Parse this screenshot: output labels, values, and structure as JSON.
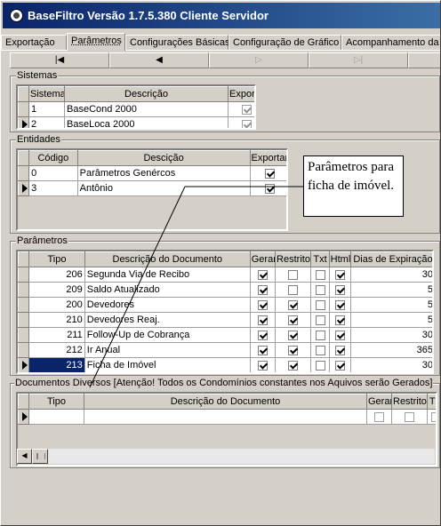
{
  "window": {
    "title": "BaseFiltro Versão 1.7.5.380 Cliente Servidor"
  },
  "tabs": [
    {
      "label": "Exportação"
    },
    {
      "label": "Parâmetros"
    },
    {
      "label": "Configurações Básicas"
    },
    {
      "label": "Configuração de Gráfico"
    },
    {
      "label": "Acompanhamento da"
    }
  ],
  "navigator": {
    "first": "|◀",
    "prior": "◀",
    "next": "▷",
    "last": "▷|"
  },
  "sistemas": {
    "legend": "Sistemas",
    "columns": [
      "Sistema",
      "Descrição",
      "Exportar"
    ],
    "rows": [
      {
        "id": "1",
        "desc": "BaseCond 2000",
        "exportar": true
      },
      {
        "id": "2",
        "desc": "BaseLoca 2000",
        "exportar": true
      }
    ]
  },
  "entidades": {
    "legend": "Entidades",
    "columns": [
      "Código",
      "Descição",
      "Exportar"
    ],
    "rows": [
      {
        "id": "0",
        "desc": "Parâmetros Genércos",
        "exportar": true
      },
      {
        "id": "3",
        "desc": "Antônio",
        "exportar": true
      }
    ]
  },
  "note": {
    "text": "Parâmetros para ficha de imóvel."
  },
  "parametros": {
    "legend": "Parâmetros",
    "columns": [
      "Tipo",
      "Descrição do Documento",
      "Gerar",
      "Restrito",
      "Txt",
      "Html",
      "Dias de Expiração"
    ],
    "rows": [
      {
        "tipo": "206",
        "desc": "Segunda Via de Recibo",
        "gerar": true,
        "restrito": false,
        "txt": false,
        "html": true,
        "dias": "30"
      },
      {
        "tipo": "209",
        "desc": "Saldo Atualizado",
        "gerar": true,
        "restrito": false,
        "txt": false,
        "html": true,
        "dias": "5"
      },
      {
        "tipo": "200",
        "desc": "Devedores",
        "gerar": true,
        "restrito": true,
        "txt": false,
        "html": true,
        "dias": "5"
      },
      {
        "tipo": "210",
        "desc": "Devedores Reaj.",
        "gerar": true,
        "restrito": true,
        "txt": false,
        "html": true,
        "dias": "5"
      },
      {
        "tipo": "211",
        "desc": "Follow-Up de Cobrança",
        "gerar": true,
        "restrito": true,
        "txt": false,
        "html": true,
        "dias": "30"
      },
      {
        "tipo": "212",
        "desc": "Ir Anual",
        "gerar": true,
        "restrito": true,
        "txt": false,
        "html": true,
        "dias": "365"
      },
      {
        "tipo": "213",
        "desc": "Ficha de Imóvel",
        "gerar": true,
        "restrito": true,
        "txt": false,
        "html": true,
        "dias": "30"
      }
    ]
  },
  "diversos": {
    "legend": "Documentos Diversos [Atenção! Todos os Condomínios constantes nos Aquivos serão Gerados]",
    "columns": [
      "Tipo",
      "Descrição do Documento",
      "Gerar",
      "Restrito",
      "Txt"
    ]
  }
}
